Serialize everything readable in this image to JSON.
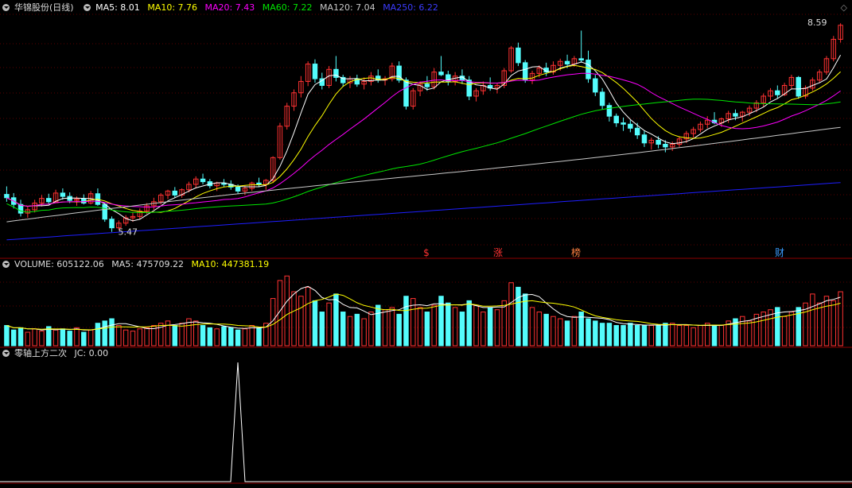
{
  "main": {
    "title": "华锦股份(日线)",
    "ma5": "MA5: 8.01",
    "ma10": "MA10: 7.76",
    "ma20": "MA20: 7.43",
    "ma60": "MA60: 7.22",
    "ma120": "MA120: 7.04",
    "ma250": "MA250: 6.22",
    "high_label": "8.59",
    "low_label": "5.47",
    "markers": [
      "$",
      "涨",
      "榜",
      "财"
    ]
  },
  "volume": {
    "label": "VOLUME: 605122.06",
    "ma5": "MA5: 475709.22",
    "ma10": "MA10: 447381.19"
  },
  "oscillator": {
    "label": "零轴上方二次",
    "jc": "JC: 0.00"
  },
  "colors": {
    "up": "#ff3232",
    "down": "#54fcfc",
    "ma5": "#ffffff",
    "ma10": "#ffff00",
    "ma20": "#ff00ff",
    "ma60": "#00e600",
    "ma120": "#c8c8c8",
    "ma250": "#1e1eff",
    "grid": "#5a0000"
  },
  "chart_data": {
    "type": "candlestick",
    "price_range": [
      5.3,
      8.7
    ],
    "candles": [
      [
        6.03,
        6.15,
        5.92,
        5.98
      ],
      [
        5.98,
        6.05,
        5.82,
        5.88
      ],
      [
        5.88,
        5.95,
        5.7,
        5.75
      ],
      [
        5.75,
        5.85,
        5.68,
        5.8
      ],
      [
        5.8,
        5.95,
        5.76,
        5.9
      ],
      [
        5.9,
        6.02,
        5.85,
        5.97
      ],
      [
        5.97,
        6.04,
        5.88,
        5.92
      ],
      [
        5.92,
        6.1,
        5.9,
        6.05
      ],
      [
        6.05,
        6.12,
        5.95,
        6.0
      ],
      [
        6.0,
        6.06,
        5.9,
        5.94
      ],
      [
        5.94,
        6.0,
        5.86,
        5.96
      ],
      [
        5.96,
        6.03,
        5.88,
        5.9
      ],
      [
        5.9,
        6.08,
        5.88,
        6.04
      ],
      [
        6.04,
        6.12,
        5.86,
        5.88
      ],
      [
        5.88,
        5.9,
        5.62,
        5.66
      ],
      [
        5.66,
        5.7,
        5.47,
        5.53
      ],
      [
        5.53,
        5.64,
        5.5,
        5.6
      ],
      [
        5.6,
        5.72,
        5.56,
        5.68
      ],
      [
        5.68,
        5.76,
        5.62,
        5.7
      ],
      [
        5.7,
        5.82,
        5.66,
        5.78
      ],
      [
        5.78,
        5.9,
        5.74,
        5.86
      ],
      [
        5.86,
        5.98,
        5.8,
        5.92
      ],
      [
        5.92,
        6.05,
        5.88,
        6.02
      ],
      [
        6.02,
        6.1,
        5.96,
        6.08
      ],
      [
        6.08,
        6.14,
        5.98,
        6.02
      ],
      [
        6.02,
        6.12,
        5.98,
        6.1
      ],
      [
        6.1,
        6.22,
        6.06,
        6.18
      ],
      [
        6.18,
        6.3,
        6.12,
        6.26
      ],
      [
        6.26,
        6.34,
        6.18,
        6.22
      ],
      [
        6.22,
        6.26,
        6.12,
        6.16
      ],
      [
        6.16,
        6.22,
        6.08,
        6.2
      ],
      [
        6.2,
        6.26,
        6.14,
        6.18
      ],
      [
        6.18,
        6.24,
        6.1,
        6.14
      ],
      [
        6.14,
        6.18,
        6.04,
        6.08
      ],
      [
        6.08,
        6.16,
        6.02,
        6.12
      ],
      [
        6.12,
        6.22,
        6.08,
        6.2
      ],
      [
        6.2,
        6.28,
        6.14,
        6.18
      ],
      [
        6.18,
        6.26,
        6.1,
        6.24
      ],
      [
        6.24,
        6.6,
        6.2,
        6.58
      ],
      [
        6.58,
        7.1,
        6.55,
        7.05
      ],
      [
        7.05,
        7.4,
        7.0,
        7.35
      ],
      [
        7.35,
        7.6,
        7.28,
        7.55
      ],
      [
        7.55,
        7.8,
        7.48,
        7.72
      ],
      [
        7.72,
        8.02,
        7.65,
        7.98
      ],
      [
        7.98,
        8.05,
        7.7,
        7.76
      ],
      [
        7.76,
        7.85,
        7.6,
        7.66
      ],
      [
        7.66,
        7.95,
        7.62,
        7.9
      ],
      [
        7.9,
        8.1,
        7.72,
        7.78
      ],
      [
        7.78,
        7.82,
        7.64,
        7.7
      ],
      [
        7.7,
        7.8,
        7.62,
        7.76
      ],
      [
        7.76,
        7.82,
        7.64,
        7.68
      ],
      [
        7.68,
        7.78,
        7.6,
        7.72
      ],
      [
        7.72,
        7.86,
        7.66,
        7.8
      ],
      [
        7.8,
        7.9,
        7.7,
        7.74
      ],
      [
        7.74,
        7.8,
        7.66,
        7.76
      ],
      [
        7.76,
        8.0,
        7.72,
        7.95
      ],
      [
        7.95,
        8.02,
        7.7,
        7.74
      ],
      [
        7.74,
        7.78,
        7.3,
        7.35
      ],
      [
        7.35,
        7.62,
        7.3,
        7.58
      ],
      [
        7.58,
        7.72,
        7.5,
        7.68
      ],
      [
        7.68,
        7.8,
        7.58,
        7.64
      ],
      [
        7.64,
        7.92,
        7.6,
        7.86
      ],
      [
        7.86,
        8.1,
        7.8,
        7.82
      ],
      [
        7.82,
        7.88,
        7.66,
        7.72
      ],
      [
        7.72,
        7.86,
        7.66,
        7.8
      ],
      [
        7.8,
        7.9,
        7.68,
        7.74
      ],
      [
        7.74,
        7.8,
        7.44,
        7.5
      ],
      [
        7.5,
        7.62,
        7.42,
        7.58
      ],
      [
        7.58,
        7.72,
        7.52,
        7.66
      ],
      [
        7.66,
        7.78,
        7.58,
        7.62
      ],
      [
        7.62,
        7.7,
        7.54,
        7.66
      ],
      [
        7.66,
        7.92,
        7.62,
        7.88
      ],
      [
        7.88,
        8.25,
        7.85,
        8.22
      ],
      [
        8.22,
        8.3,
        7.95,
        8.0
      ],
      [
        8.0,
        8.04,
        7.7,
        7.74
      ],
      [
        7.74,
        7.88,
        7.68,
        7.84
      ],
      [
        7.84,
        7.96,
        7.78,
        7.92
      ],
      [
        7.92,
        8.0,
        7.8,
        7.86
      ],
      [
        7.86,
        8.02,
        7.82,
        7.96
      ],
      [
        7.96,
        8.06,
        7.88,
        8.02
      ],
      [
        8.02,
        8.12,
        7.92,
        7.98
      ],
      [
        7.98,
        8.1,
        7.94,
        8.06
      ],
      [
        8.06,
        8.48,
        8.0,
        8.04
      ],
      [
        8.04,
        8.18,
        7.7,
        7.76
      ],
      [
        7.76,
        7.82,
        7.5,
        7.56
      ],
      [
        7.56,
        7.62,
        7.3,
        7.36
      ],
      [
        7.36,
        7.4,
        7.12,
        7.2
      ],
      [
        7.2,
        7.24,
        7.04,
        7.1
      ],
      [
        7.1,
        7.18,
        6.98,
        7.08
      ],
      [
        7.08,
        7.14,
        6.96,
        7.02
      ],
      [
        7.02,
        7.1,
        6.86,
        6.92
      ],
      [
        6.92,
        6.98,
        6.74,
        6.8
      ],
      [
        6.8,
        6.88,
        6.7,
        6.84
      ],
      [
        6.84,
        6.9,
        6.72,
        6.78
      ],
      [
        6.78,
        6.84,
        6.66,
        6.74
      ],
      [
        6.74,
        6.82,
        6.68,
        6.78
      ],
      [
        6.78,
        6.9,
        6.74,
        6.86
      ],
      [
        6.86,
        6.98,
        6.8,
        6.94
      ],
      [
        6.94,
        7.04,
        6.88,
        7.0
      ],
      [
        7.0,
        7.12,
        6.96,
        7.08
      ],
      [
        7.08,
        7.2,
        7.02,
        7.14
      ],
      [
        7.14,
        7.26,
        7.08,
        7.1
      ],
      [
        7.1,
        7.18,
        7.04,
        7.16
      ],
      [
        7.16,
        7.28,
        7.1,
        7.24
      ],
      [
        7.24,
        7.3,
        7.14,
        7.2
      ],
      [
        7.2,
        7.28,
        7.12,
        7.26
      ],
      [
        7.26,
        7.36,
        7.2,
        7.32
      ],
      [
        7.32,
        7.44,
        7.26,
        7.4
      ],
      [
        7.4,
        7.54,
        7.34,
        7.5
      ],
      [
        7.5,
        7.62,
        7.44,
        7.58
      ],
      [
        7.58,
        7.66,
        7.46,
        7.52
      ],
      [
        7.52,
        7.7,
        7.5,
        7.66
      ],
      [
        7.66,
        7.82,
        7.6,
        7.78
      ],
      [
        7.78,
        7.8,
        7.46,
        7.5
      ],
      [
        7.5,
        7.66,
        7.46,
        7.62
      ],
      [
        7.62,
        7.78,
        7.58,
        7.74
      ],
      [
        7.74,
        7.9,
        7.7,
        7.86
      ],
      [
        7.86,
        8.1,
        7.82,
        8.06
      ],
      [
        8.06,
        8.4,
        8.02,
        8.35
      ],
      [
        8.35,
        8.59,
        8.3,
        8.56
      ]
    ],
    "volume": [
      18,
      14,
      16,
      12,
      15,
      13,
      17,
      14,
      15,
      13,
      16,
      12,
      14,
      20,
      22,
      24,
      18,
      14,
      13,
      15,
      16,
      18,
      20,
      22,
      18,
      20,
      24,
      22,
      18,
      16,
      15,
      17,
      16,
      14,
      15,
      18,
      16,
      20,
      42,
      58,
      62,
      48,
      44,
      52,
      40,
      30,
      38,
      46,
      30,
      26,
      28,
      24,
      30,
      36,
      32,
      34,
      28,
      44,
      42,
      34,
      30,
      36,
      44,
      38,
      34,
      30,
      40,
      36,
      30,
      34,
      32,
      40,
      56,
      52,
      46,
      34,
      30,
      28,
      26,
      24,
      22,
      26,
      30,
      24,
      22,
      20,
      20,
      18,
      18,
      20,
      18,
      18,
      18,
      18,
      20,
      20,
      18,
      18,
      16,
      18,
      20,
      18,
      18,
      22,
      24,
      26,
      22,
      28,
      30,
      32,
      34,
      26,
      30,
      34,
      38,
      46,
      38,
      44,
      40,
      48
    ],
    "volume_range": [
      0,
      65
    ],
    "jc": "spike at bar 37"
  }
}
